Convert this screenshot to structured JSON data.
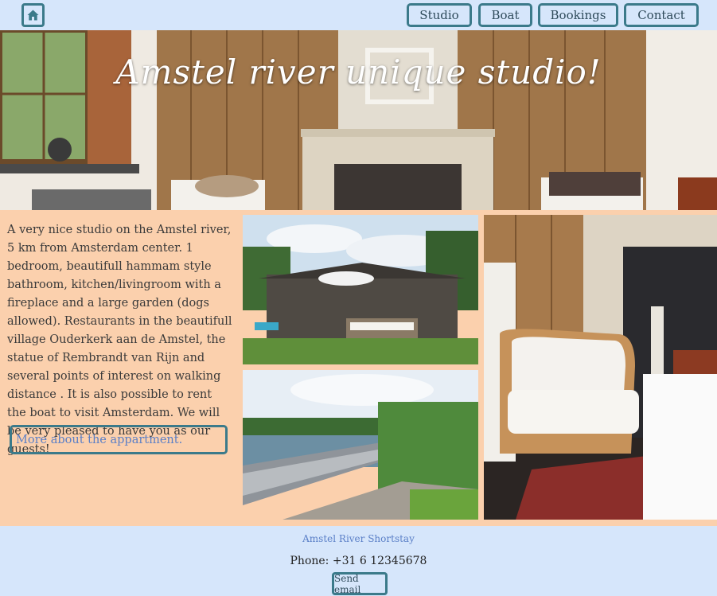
{
  "nav": {
    "home_icon": "home-icon",
    "items": [
      {
        "label": "Studio"
      },
      {
        "label": "Boat"
      },
      {
        "label": "Bookings"
      },
      {
        "label": "Contact"
      }
    ]
  },
  "hero": {
    "title": "Amstel river unique studio!"
  },
  "main": {
    "description": "A very nice studio on the Amstel river, 5 km from Amsterdam center. 1 bedroom, beautifull hammam style bathroom, kitchen/livingroom with a fireplace and a large garden (dogs allowed). Restaurants in the beautifull village Ouderkerk aan de Amstel, the statue of Rembrandt van Rijn and several points of interest on walking distance . It is also possible to rent the boat to visit Amsterdam. We will be very pleased to have you as our guests!",
    "more_label": "More about the appartment."
  },
  "footer": {
    "company": "Amstel River Shortstay",
    "phone": "Phone: +31 6 12345678",
    "email_label": "Send email"
  },
  "colors": {
    "nav_bg": "#d6e6fb",
    "page_bg": "#fbd0ad",
    "button_border": "#3b7a8a",
    "link": "#5a7fc7"
  }
}
